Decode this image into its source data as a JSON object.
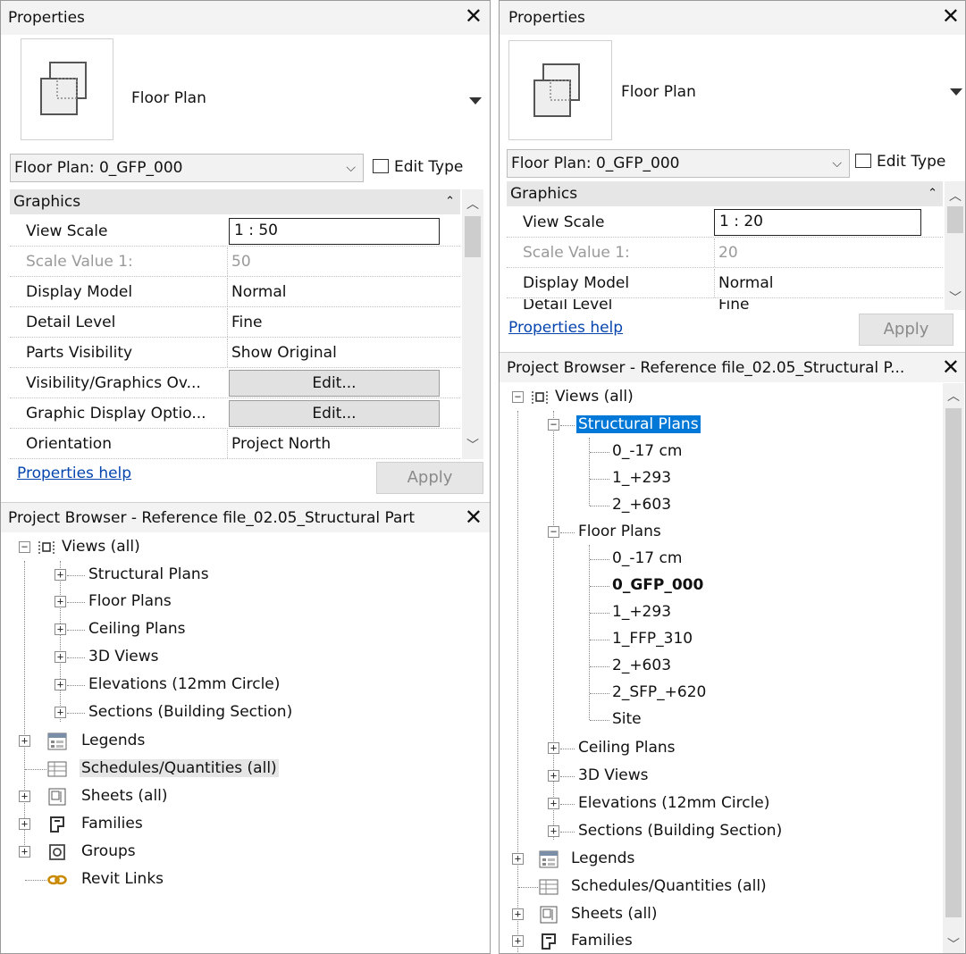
{
  "left": {
    "properties": {
      "title": "Properties",
      "close": "✕",
      "type_name": "Floor Plan",
      "instance_selector": "Floor Plan: 0_GFP_000",
      "edit_type": "Edit Type",
      "group_header": "Graphics",
      "rows": [
        {
          "key": "View Scale",
          "value": "1 : 50"
        },
        {
          "key": "Scale Value    1:",
          "value": "50"
        },
        {
          "key": "Display Model",
          "value": "Normal"
        },
        {
          "key": "Detail Level",
          "value": "Fine"
        },
        {
          "key": "Parts Visibility",
          "value": "Show Original"
        },
        {
          "key": "Visibility/Graphics Ov...",
          "value": "Edit..."
        },
        {
          "key": "Graphic Display Optio...",
          "value": "Edit..."
        },
        {
          "key": "Orientation",
          "value": "Project North"
        }
      ],
      "help": "Properties help",
      "apply": "Apply"
    },
    "browser": {
      "title": "Project Browser - Reference file_02.05_Structural Part",
      "close": "✕",
      "views_root": "Views (all)",
      "view_groups": [
        "Structural Plans",
        "Floor Plans",
        "Ceiling Plans",
        "3D Views",
        "Elevations (12mm Circle)",
        "Sections (Building Section)"
      ],
      "legends": "Legends",
      "schedules": "Schedules/Quantities (all)",
      "sheets": "Sheets (all)",
      "families": "Families",
      "groups": "Groups",
      "revit_links": "Revit Links"
    }
  },
  "right": {
    "properties": {
      "title": "Properties",
      "close": "✕",
      "type_name": "Floor Plan",
      "instance_selector": "Floor Plan: 0_GFP_000",
      "edit_type": "Edit Type",
      "group_header": "Graphics",
      "rows": [
        {
          "key": "View Scale",
          "value": "1 : 20"
        },
        {
          "key": "Scale Value    1:",
          "value": "20"
        },
        {
          "key": "Display Model",
          "value": "Normal"
        },
        {
          "key": "Detail Level",
          "value": "Fine"
        }
      ],
      "help": "Properties help",
      "apply": "Apply"
    },
    "browser": {
      "title": "Project Browser - Reference file_02.05_Structural P...",
      "close": "✕",
      "views_root": "Views (all)",
      "structural_plans": "Structural Plans",
      "structural_items": [
        "0_-17 cm",
        "1_+293",
        "2_+603"
      ],
      "floor_plans": "Floor Plans",
      "floor_items": [
        "0_-17 cm",
        "0_GFP_000",
        "1_+293",
        "1_FFP_310",
        "2_+603",
        "2_SFP_+620",
        "Site"
      ],
      "other_groups": [
        "Ceiling Plans",
        "3D Views",
        "Elevations (12mm Circle)",
        "Sections (Building Section)"
      ],
      "legends": "Legends",
      "schedules": "Schedules/Quantities (all)",
      "sheets": "Sheets (all)",
      "families": "Families"
    }
  },
  "colors": {
    "selection": "#0078d7",
    "link": "#0645ad",
    "panel_header": "#f3f3f3"
  }
}
